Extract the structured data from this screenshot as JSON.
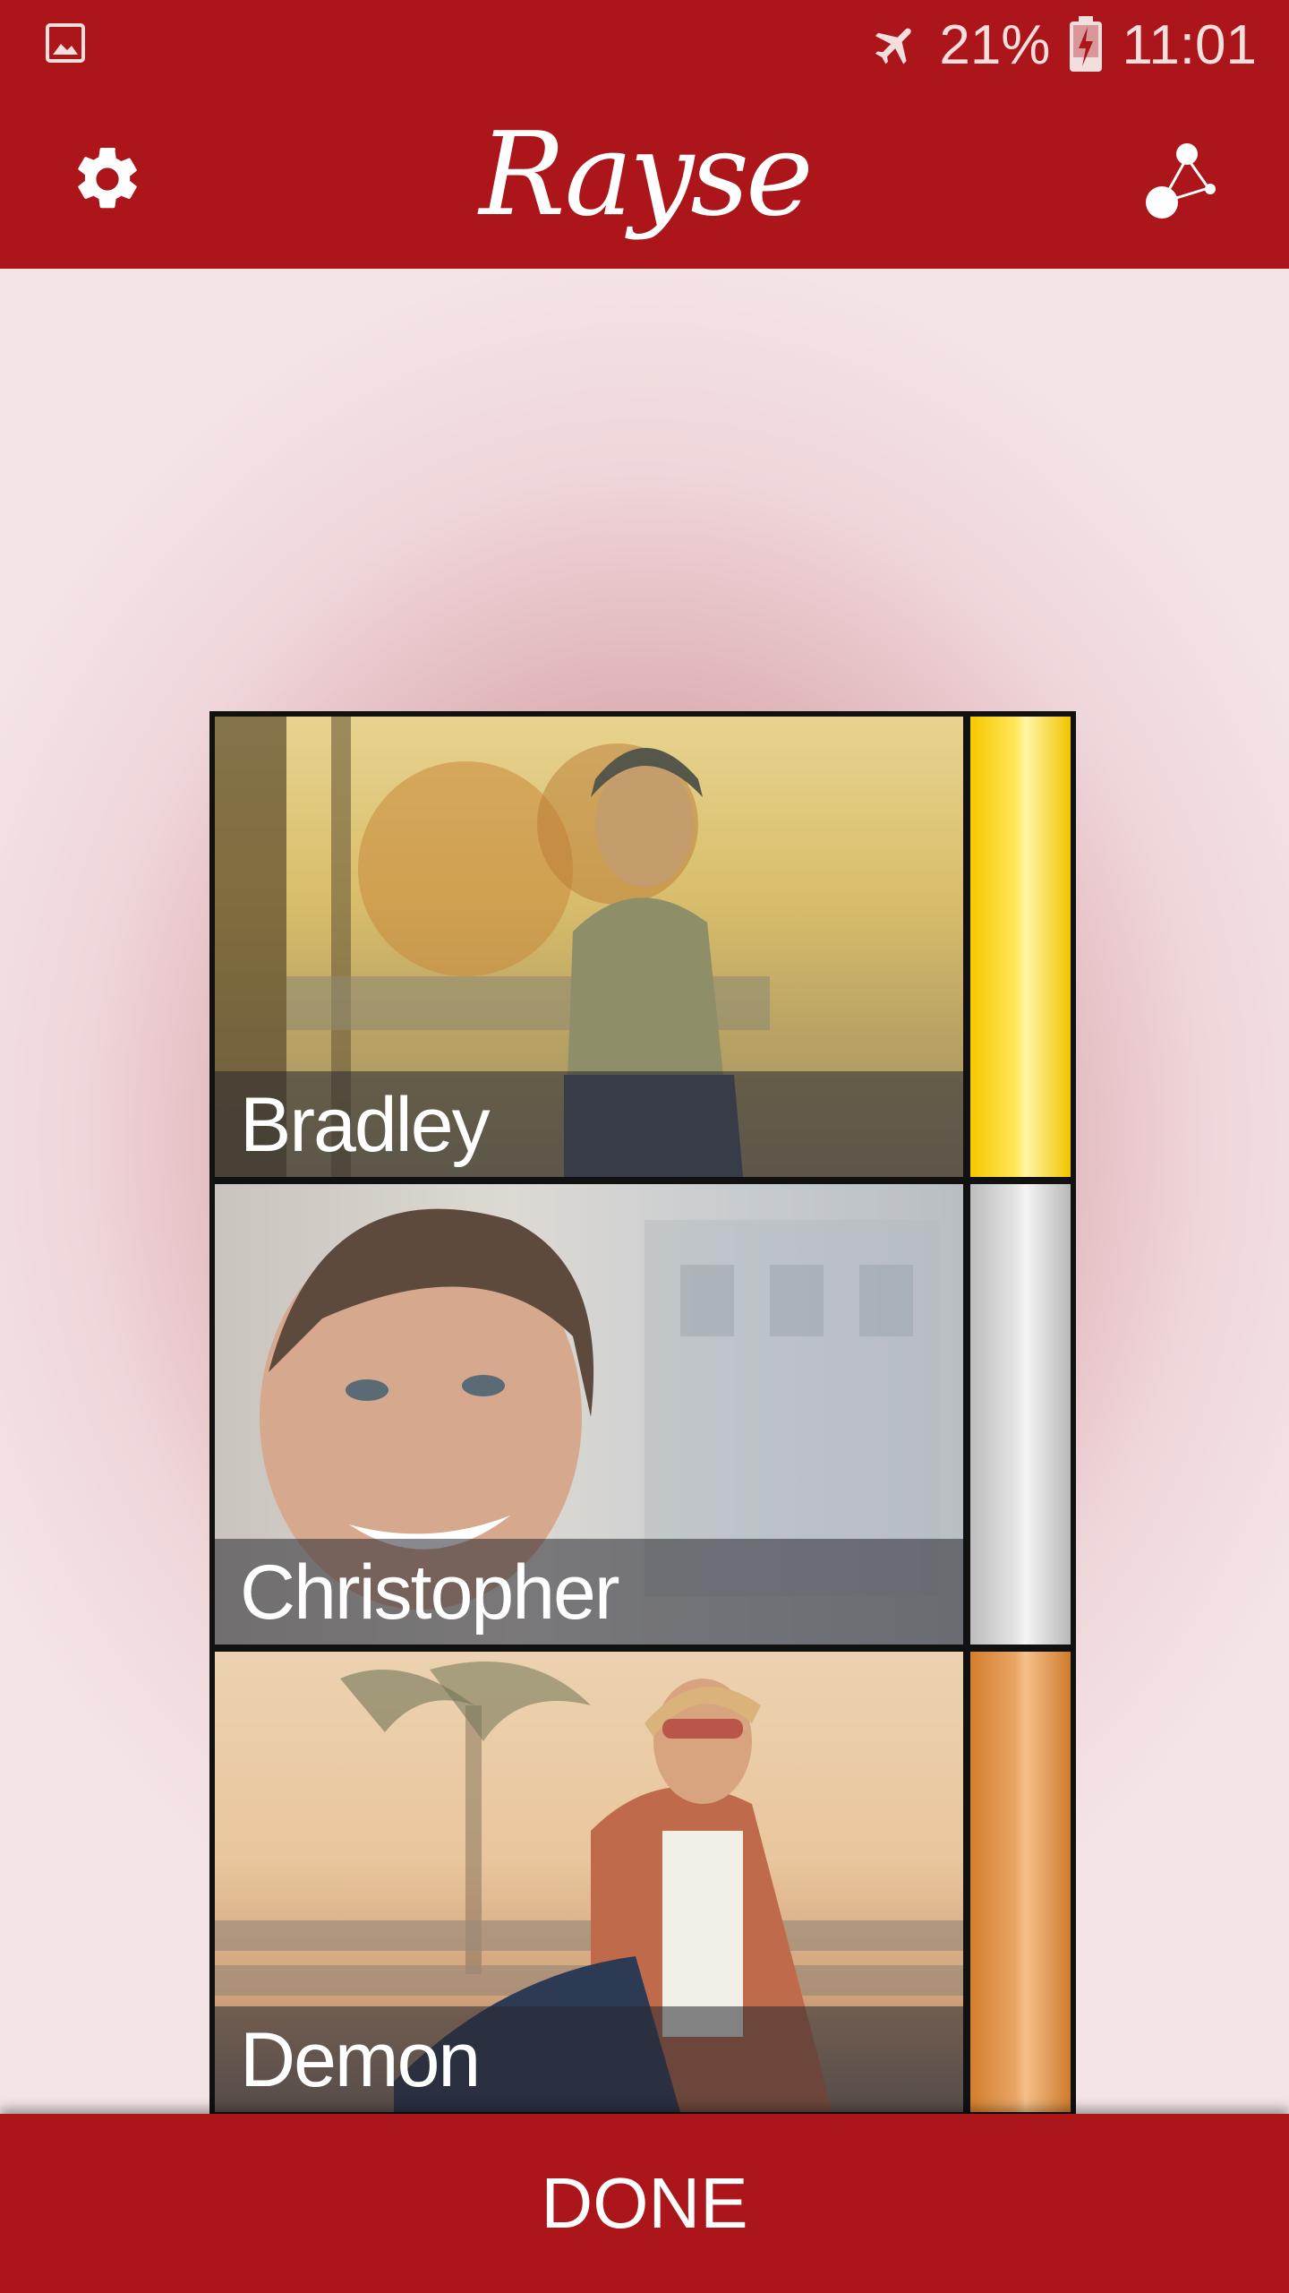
{
  "status_bar": {
    "battery_percent": "21%",
    "time": "11:01",
    "icons": [
      "gallery-icon",
      "airplane-mode-icon",
      "battery-charging-icon"
    ]
  },
  "app_bar": {
    "title": "Rayse",
    "icons": [
      "gear-icon",
      "share-icon"
    ]
  },
  "ranking": {
    "items": [
      {
        "name": "Bradley",
        "medal": "gold",
        "medal_color": "#f7c800"
      },
      {
        "name": "Christopher",
        "medal": "silver",
        "medal_color": "#c8c8c8"
      },
      {
        "name": "Demon",
        "medal": "bronze",
        "medal_color": "#d27f2d"
      }
    ]
  },
  "footer": {
    "done_label": "DONE"
  },
  "colors": {
    "brand": "#ac1519",
    "background": "#f4e4e6"
  }
}
